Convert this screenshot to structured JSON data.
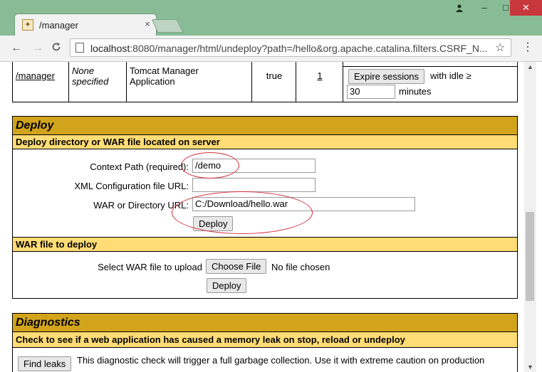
{
  "browser": {
    "tab_title": "/manager",
    "tab_close": "×",
    "url_host": "localhost",
    "url_rest": ":8080/manager/html/undeploy?path=/hello&org.apache.catalina.filters.CSRF_N...",
    "icons": {
      "back": "←",
      "forward": "→",
      "reload": "C",
      "star": "☆",
      "menu": "⋮",
      "user": "👤",
      "minimize": "–",
      "maximize": "□",
      "close": "✕"
    }
  },
  "app_row": {
    "path": "/manager",
    "version": "None specified",
    "display_name": "Tomcat Manager Application",
    "running": "true",
    "sessions": "1",
    "expire_button": "Expire sessions",
    "with_idle": "with idle ≥",
    "idle_value": "30",
    "minutes": "minutes"
  },
  "deploy": {
    "title": "Deploy",
    "server_subtitle": "Deploy directory or WAR file located on server",
    "context_path_label": "Context Path (required):",
    "context_path_value": "/demo",
    "xml_config_label": "XML Configuration file URL:",
    "xml_config_value": "",
    "war_dir_label": "WAR or Directory URL:",
    "war_dir_value": "C:/Download/hello.war",
    "deploy_button": "Deploy",
    "war_subtitle": "WAR file to deploy",
    "select_war_label": "Select WAR file to upload",
    "choose_file_button": "Choose File",
    "no_file_text": "No file chosen",
    "upload_deploy_button": "Deploy"
  },
  "diagnostics": {
    "title": "Diagnostics",
    "subtitle": "Check to see if a web application has caused a memory leak on stop, reload or undeploy",
    "find_leaks_button": "Find leaks",
    "description": "This diagnostic check will trigger a full garbage collection. Use it with extreme caution on production"
  },
  "colors": {
    "section_header": "#d2a41c",
    "subheader": "#ffdc75",
    "annotation": "#d4303a",
    "window_frame": "#88bc95",
    "close_button": "#c7373b"
  }
}
